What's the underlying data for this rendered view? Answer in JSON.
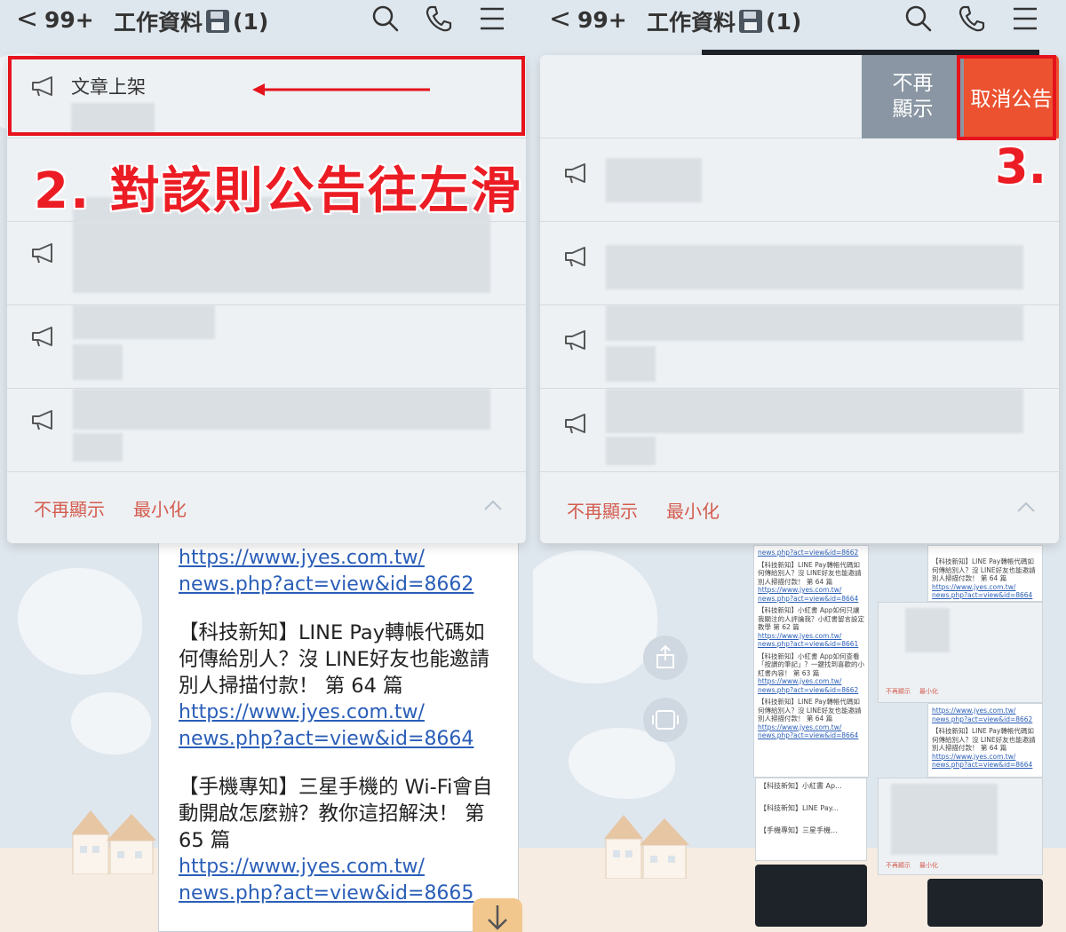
{
  "header": {
    "back_glyph": "<",
    "unread": "99+",
    "title": "工作資料",
    "member_count": "(1)",
    "icons": [
      "search-icon",
      "phone-icon",
      "menu-icon",
      "floppy-disk-icon"
    ]
  },
  "announcement": {
    "first_title": "文章上架",
    "footer": {
      "dont_show": "不再顯示",
      "minimize": "最小化"
    },
    "actions": {
      "dont_show": "不再\n顯示",
      "cancel": "取消公告"
    }
  },
  "annotations": {
    "step2": "2. 對該則公告往左滑",
    "step3": "3."
  },
  "message": {
    "link1a": "https://www.jyes.com.tw/",
    "link1b": "news.php?act=view&id=8662",
    "text2": "【科技新知】LINE Pay轉帳代碼如何傳給別人？沒 LINE好友也能邀請別人掃描付款！ 第 64 篇",
    "link2a": "https://www.jyes.com.tw/",
    "link2b": "news.php?act=view&id=8664",
    "text3": "【手機專知】三星手機的 Wi-Fi會自動開啟怎麼辦？教你這招解決！ 第 65 篇",
    "link3a": "https://www.jyes.com.tw/",
    "link3b": "news.php?act=view&id=8665"
  },
  "thumbnails": {
    "t1_link": "news.php?act=view&id=8662",
    "t1_text": "【科技新知】LINE Pay轉帳代碼如何傳給別人？沒 LINE好友也能邀請別人掃描付款！ 第 64 篇",
    "t1_url": "https://www.jyes.com.tw/",
    "t1_id": "news.php?act=view&id=8664",
    "t2_text": "【科技新知】小紅書 App如何只讓我關注的人評論我？小紅書留言設定教學 第 62 篇",
    "t2_url": "https://www.jyes.com.tw/",
    "t2_id": "news.php?act=view&id=8661",
    "t3_text": "【科技新知】小紅書 App如何查看「按讚的筆記」？一鍵找到喜歡的小紅書內容！ 第 63 篇",
    "t3_url": "https://www.jyes.com.tw/",
    "t3_id": "news.php?act=view&id=8662",
    "t4_text": "【科技新知】LINE Pay轉帳代碼如何傳給別人？沒 LINE好友也能邀請別人掃描付款！ 第 64 篇",
    "t4_url": "https://www.jyes.com.tw/",
    "t4_id": "news.php?act=view&id=8664",
    "r1_text": "【科技新知】LINE Pay轉帳代碼如何傳給別人？沒 LINE好友也能邀請別人掃描付款！ 第 64 篇",
    "r1_url": "https://www.jyes.com.tw/",
    "r1_id": "news.php?act=view&id=8664",
    "r2_url": "https://www.jyes.com.tw/",
    "r2_id": "news.php?act=view&id=8662",
    "r2_text": "【科技新知】LINE Pay轉帳代碼如何傳給別人？沒 LINE好友也能邀請別人掃描付款！ 第 64 篇",
    "r2_url2": "https://www.jyes.com.tw/",
    "r2_id2": "news.php?act=view&id=8664",
    "small_dont_show": "不再顯示",
    "small_minimize": "最小化",
    "list1": "【科技新知】小紅書 Ap...",
    "list2": "【科技新知】LINE Pay...",
    "list3": "【手機專知】三星手機..."
  },
  "colors": {
    "accent_red": "#ec5230",
    "annotation_red": "#e5131c",
    "link_blue": "#2a5eb8",
    "footer_text": "#d45b4e"
  }
}
